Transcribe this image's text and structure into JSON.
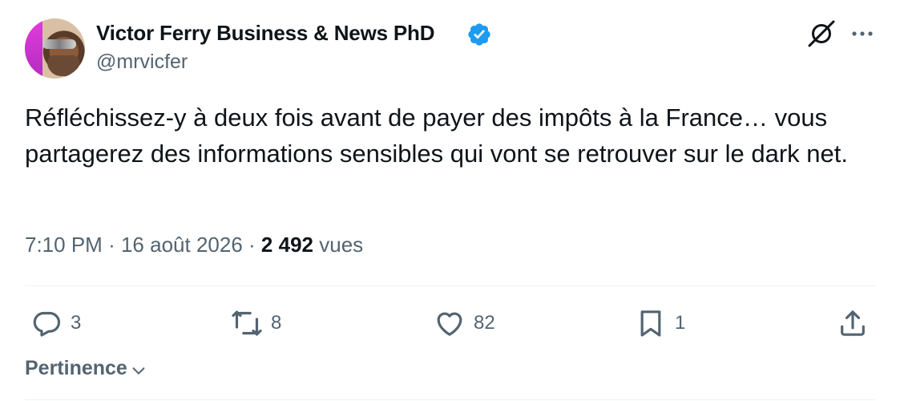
{
  "author": {
    "name": "Victor Ferry Business & News PhD",
    "handle": "@mrvicfer"
  },
  "tweet": {
    "text": "Réfléchissez-y à deux fois avant de payer des impôts à la France… vous partagerez des informations sensibles qui vont se retrouver sur le dark net."
  },
  "meta": {
    "time": "7:10 PM",
    "separator": "·",
    "date": "16 août 2026",
    "views_count": "2 492",
    "views_label": "vues"
  },
  "actions": {
    "replies": "3",
    "retweets": "8",
    "likes": "82",
    "bookmarks": "1"
  },
  "sort": {
    "label": "Pertinence"
  },
  "colors": {
    "verified": "#1d9bf0",
    "text": "#0f1419",
    "secondary": "#536471",
    "divider": "#eff3f4"
  },
  "icons": [
    "verified-badge-icon",
    "grok-icon",
    "more-icon",
    "reply-icon",
    "retweet-icon",
    "like-icon",
    "bookmark-icon",
    "share-icon",
    "chevron-down-icon"
  ]
}
